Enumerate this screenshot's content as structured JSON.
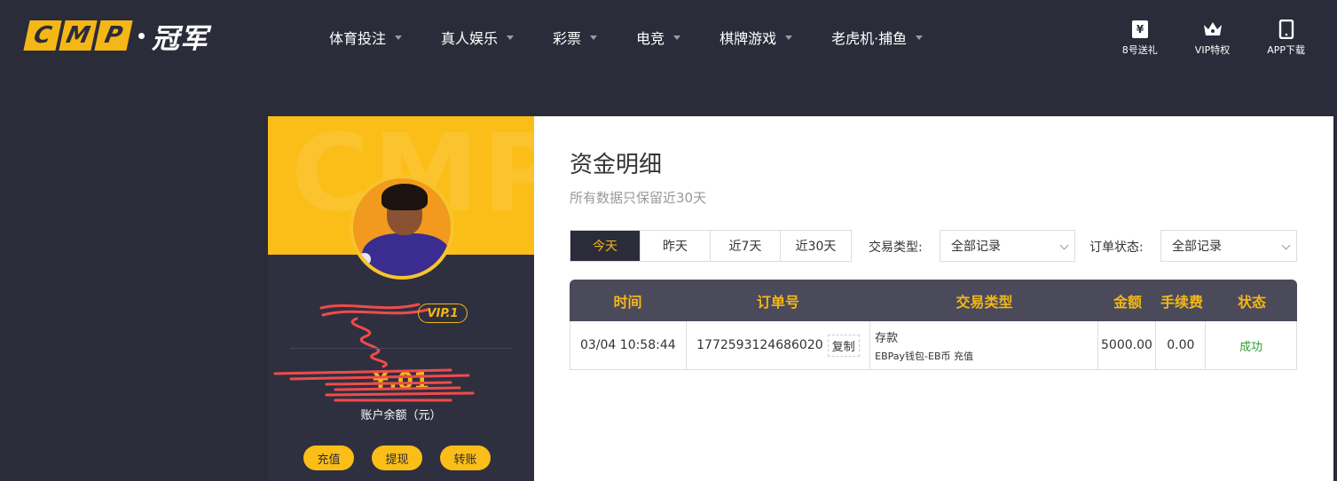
{
  "header": {
    "logo_letters": [
      "C",
      "M",
      "P"
    ],
    "logo_cn": "冠军",
    "nav": [
      {
        "label": "体育投注"
      },
      {
        "label": "真人娱乐"
      },
      {
        "label": "彩票"
      },
      {
        "label": "电竞"
      },
      {
        "label": "棋牌游戏"
      },
      {
        "label": "老虎机·捕鱼"
      }
    ],
    "top_icons": [
      {
        "label": "8号送礼",
        "icon": "yen-gift-icon"
      },
      {
        "label": "VIP特权",
        "icon": "crown-icon"
      },
      {
        "label": "APP下载",
        "icon": "tablet-icon"
      }
    ]
  },
  "profile": {
    "watermark": "CMP",
    "vip": "VIP.1",
    "balance": "¥.01",
    "balance_label": "账户余额（元）",
    "actions": [
      "充值",
      "提现",
      "转账"
    ]
  },
  "main": {
    "title": "资金明细",
    "subtitle": "所有数据只保留近30天",
    "ranges": [
      "今天",
      "昨天",
      "近7天",
      "近30天"
    ],
    "active_range": "今天",
    "tx_type_label": "交易类型:",
    "tx_type_value": "全部记录",
    "order_status_label": "订单状态:",
    "order_status_value": "全部记录",
    "table": {
      "headers": [
        "时间",
        "订单号",
        "交易类型",
        "金额",
        "手续费",
        "状态"
      ],
      "rows": [
        {
          "time": "03/04 10:58:44",
          "order_no": "1772593124686020",
          "copy": "复制",
          "type": "存款",
          "type_detail": "EBPay钱包-EB币 充值",
          "amount": "5000.00",
          "fee": "0.00",
          "status": "成功"
        }
      ]
    }
  },
  "colors": {
    "accent": "#f5b716",
    "dark": "#2b2c3a",
    "success": "#2e9e2e"
  }
}
